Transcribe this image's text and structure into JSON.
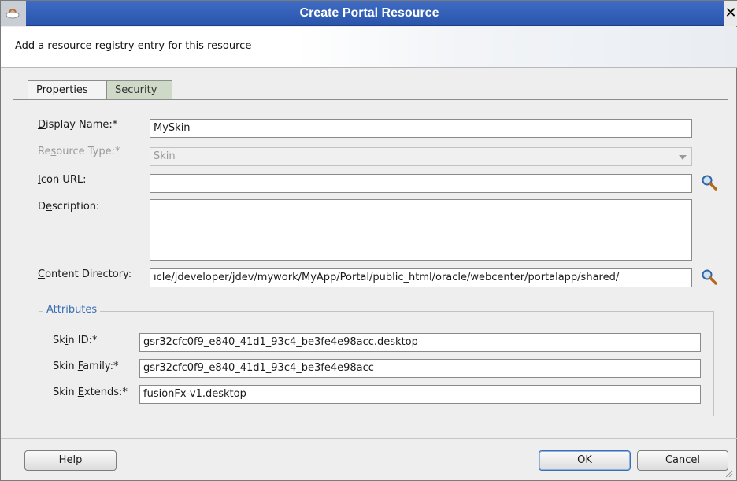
{
  "window": {
    "title": "Create Portal Resource",
    "close_glyph": "✕"
  },
  "header": {
    "subtitle": "Add a resource registry entry for this resource"
  },
  "tabs": [
    {
      "label": "Properties",
      "active": true
    },
    {
      "label": "Security",
      "active": false
    }
  ],
  "form": {
    "display_name": {
      "label_pre": "",
      "mnemonic": "D",
      "label_post": "isplay Name:*",
      "value": "MySkin"
    },
    "resource_type": {
      "label_pre": "Re",
      "mnemonic": "s",
      "label_post": "ource Type:*",
      "value": "Skin",
      "disabled": true
    },
    "icon_url": {
      "label_pre": "",
      "mnemonic": "I",
      "label_post": "con URL:",
      "value": ""
    },
    "description": {
      "label_pre": "D",
      "mnemonic": "e",
      "label_post": "scription:",
      "value": ""
    },
    "content_directory": {
      "label_pre": "",
      "mnemonic": "C",
      "label_post": "ontent Directory:",
      "value": "ıcle/jdeveloper/jdev/mywork/MyApp/Portal/public_html/oracle/webcenter/portalapp/shared/"
    }
  },
  "attributes": {
    "legend": "Attributes",
    "skin_id": {
      "label_pre": "Sk",
      "mnemonic": "i",
      "label_post": "n ID:*",
      "value": "gsr32cfc0f9_e840_41d1_93c4_be3fe4e98acc.desktop"
    },
    "skin_family": {
      "label_pre": "Skin ",
      "mnemonic": "F",
      "label_post": "amily:*",
      "value": "gsr32cfc0f9_e840_41d1_93c4_be3fe4e98acc"
    },
    "skin_extends": {
      "label_pre": "Skin ",
      "mnemonic": "E",
      "label_post": "xtends:*",
      "value": "fusionFx-v1.desktop"
    }
  },
  "buttons": {
    "help": {
      "pre": "",
      "mnemonic": "H",
      "post": "elp"
    },
    "ok": {
      "pre": "",
      "mnemonic": "O",
      "post": "K"
    },
    "cancel": {
      "pre": "",
      "mnemonic": "C",
      "post": "ancel"
    }
  },
  "colors": {
    "title_bar": "#2f5fb8",
    "legend_text": "#3a6fb5",
    "inactive_tab": "#cfd9c8"
  },
  "icons": {
    "search": "magnifier-icon",
    "app": "jdeveloper-icon"
  }
}
